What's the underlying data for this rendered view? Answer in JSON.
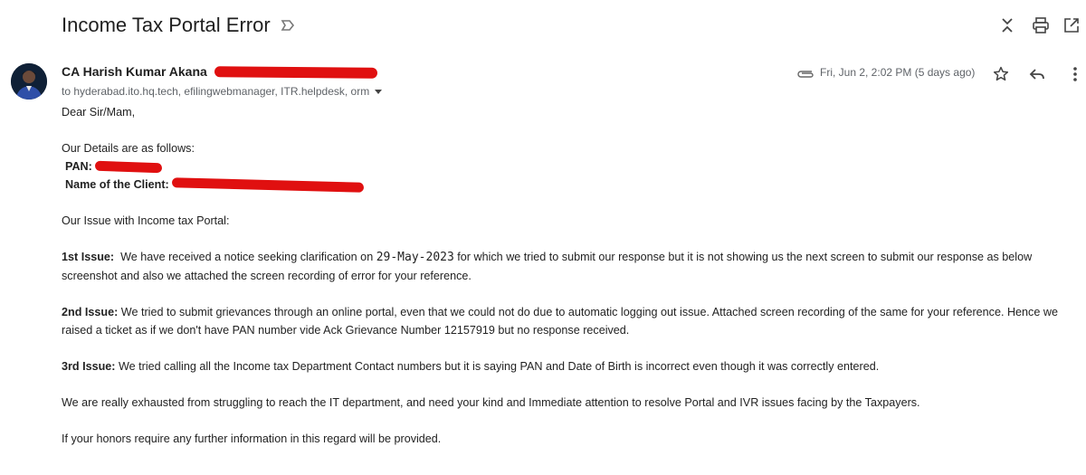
{
  "email": {
    "subject": "Income Tax Portal Error",
    "sender_name": "CA Harish Kumar Akana",
    "recipients": "to hyderabad.ito.hq.tech, efilingwebmanager, ITR.helpdesk, orm",
    "date": "Fri, Jun 2, 2:02 PM (5 days ago)"
  },
  "body": {
    "greeting": "Dear Sir/Mam,",
    "details_intro": "Our Details are as follows:",
    "pan_label": "PAN:",
    "client_label": "Name of the Client:",
    "issue_intro": "Our Issue with Income tax Portal:",
    "issue1_label": "1st Issue:",
    "issue1_text_a": "We have received a notice seeking clarification on",
    "issue1_date": "29-May-2023",
    "issue1_text_b": "for which we tried to submit our response but it is not showing us the next screen to submit our response as below screenshot and also we attached the screen recording of error for your reference.",
    "issue2_label": "2nd Issue:",
    "issue2_text": "We tried to submit grievances through an online portal, even that we could not do due to automatic logging out issue. Attached screen recording of the same for your reference. Hence we raised a ticket as if we don't have PAN number vide Ack Grievance Number 12157919 but no response received.",
    "issue3_label": "3rd Issue:",
    "issue3_text": "We tried calling all the Income tax Department Contact numbers but it is saying PAN and Date of Birth is incorrect even though it was correctly entered.",
    "closing1": "We are really exhausted from struggling to reach the IT department, and need your kind and Immediate attention to resolve  Portal  and IVR issues facing by the Taxpayers.",
    "closing2": "If your honors require any further information in this regard will be provided."
  },
  "icons": {
    "top_bar": [
      "expand-collapse-icon",
      "print-icon",
      "open-in-new-window-icon"
    ],
    "header": [
      "attachment-icon",
      "star-icon",
      "reply-icon",
      "more-vertical-icon"
    ],
    "label": "label-icon"
  },
  "colors": {
    "redaction": "#e01010",
    "secondary_text": "#5f6368"
  }
}
